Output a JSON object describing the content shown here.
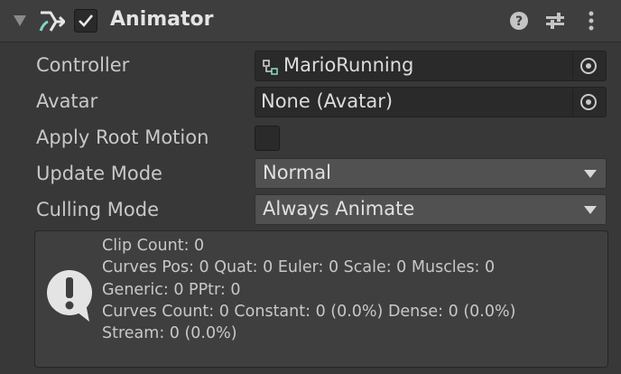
{
  "component": {
    "title": "Animator",
    "enabled": true,
    "icons": {
      "foldout": "foldout-expanded-icon",
      "component": "animator-component-icon",
      "help": "help-icon",
      "presets": "presets-icon",
      "menu": "kebab-menu-icon"
    }
  },
  "fields": {
    "controller": {
      "label": "Controller",
      "value": "MarioRunning",
      "icon": "animator-controller-icon"
    },
    "avatar": {
      "label": "Avatar",
      "value": "None (Avatar)"
    },
    "apply_root_motion": {
      "label": "Apply Root Motion",
      "checked": false
    },
    "update_mode": {
      "label": "Update Mode",
      "value": "Normal"
    },
    "culling_mode": {
      "label": "Culling Mode",
      "value": "Always Animate"
    }
  },
  "info": {
    "icon": "info-icon",
    "lines": [
      "Clip Count: 0",
      "Curves Pos: 0 Quat: 0 Euler: 0 Scale: 0 Muscles: 0",
      "Generic: 0 PPtr: 0",
      "Curves Count: 0 Constant: 0 (0.0%) Dense: 0 (0.0%)",
      "Stream: 0 (0.0%)"
    ]
  },
  "colors": {
    "panel_bg": "#383838",
    "header_bg": "#3e3e3e",
    "field_bg": "#2a2a2a",
    "dropdown_bg": "#515151",
    "icon_accent": "#7fd6c2"
  }
}
